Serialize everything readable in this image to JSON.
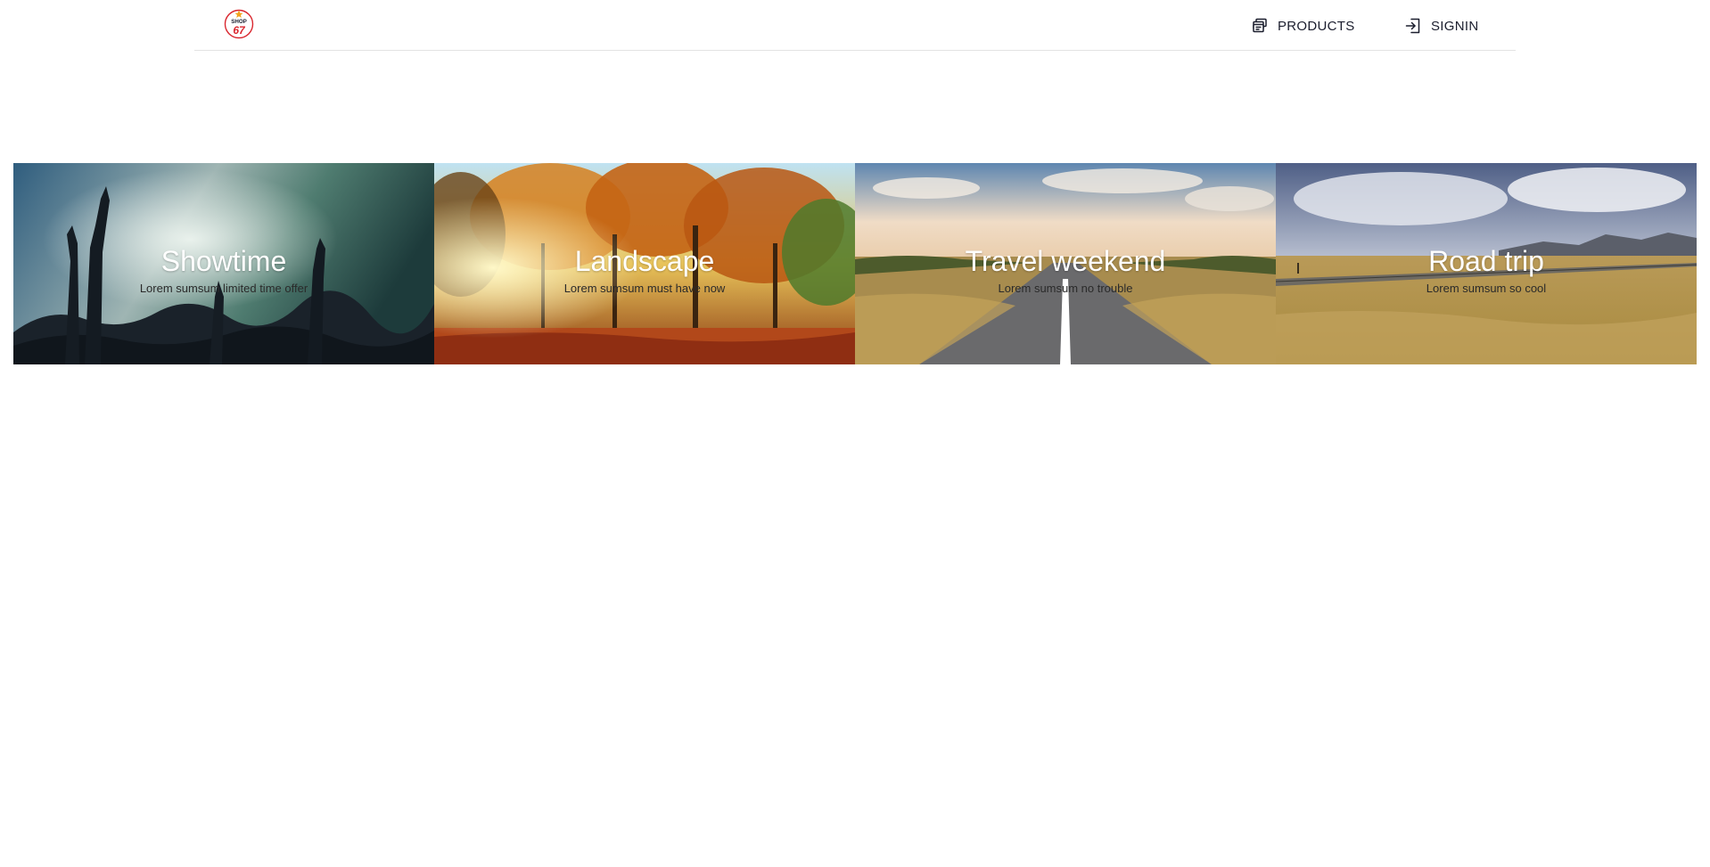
{
  "header": {
    "logo": {
      "top_text": "SHOP",
      "number": "67",
      "icon": "shop67-logo"
    },
    "nav": [
      {
        "label": "PRODUCTS",
        "icon": "products-icon"
      },
      {
        "label": "SIGNIN",
        "icon": "signin-icon"
      }
    ]
  },
  "hero": {
    "cards": [
      {
        "title": "Showtime",
        "subtitle": "Lorem sumsum limited time offer"
      },
      {
        "title": "Landscape",
        "subtitle": "Lorem sumsum must have now"
      },
      {
        "title": "Travel weekend",
        "subtitle": "Lorem sumsum no trouble"
      },
      {
        "title": "Road trip",
        "subtitle": "Lorem sumsum so cool"
      }
    ]
  },
  "colors": {
    "text": "#1b1e2e",
    "divider": "#e3e3e3",
    "logo_red": "#d9262e",
    "logo_blue": "#1e3f8f",
    "logo_star": "#f2a31b"
  }
}
